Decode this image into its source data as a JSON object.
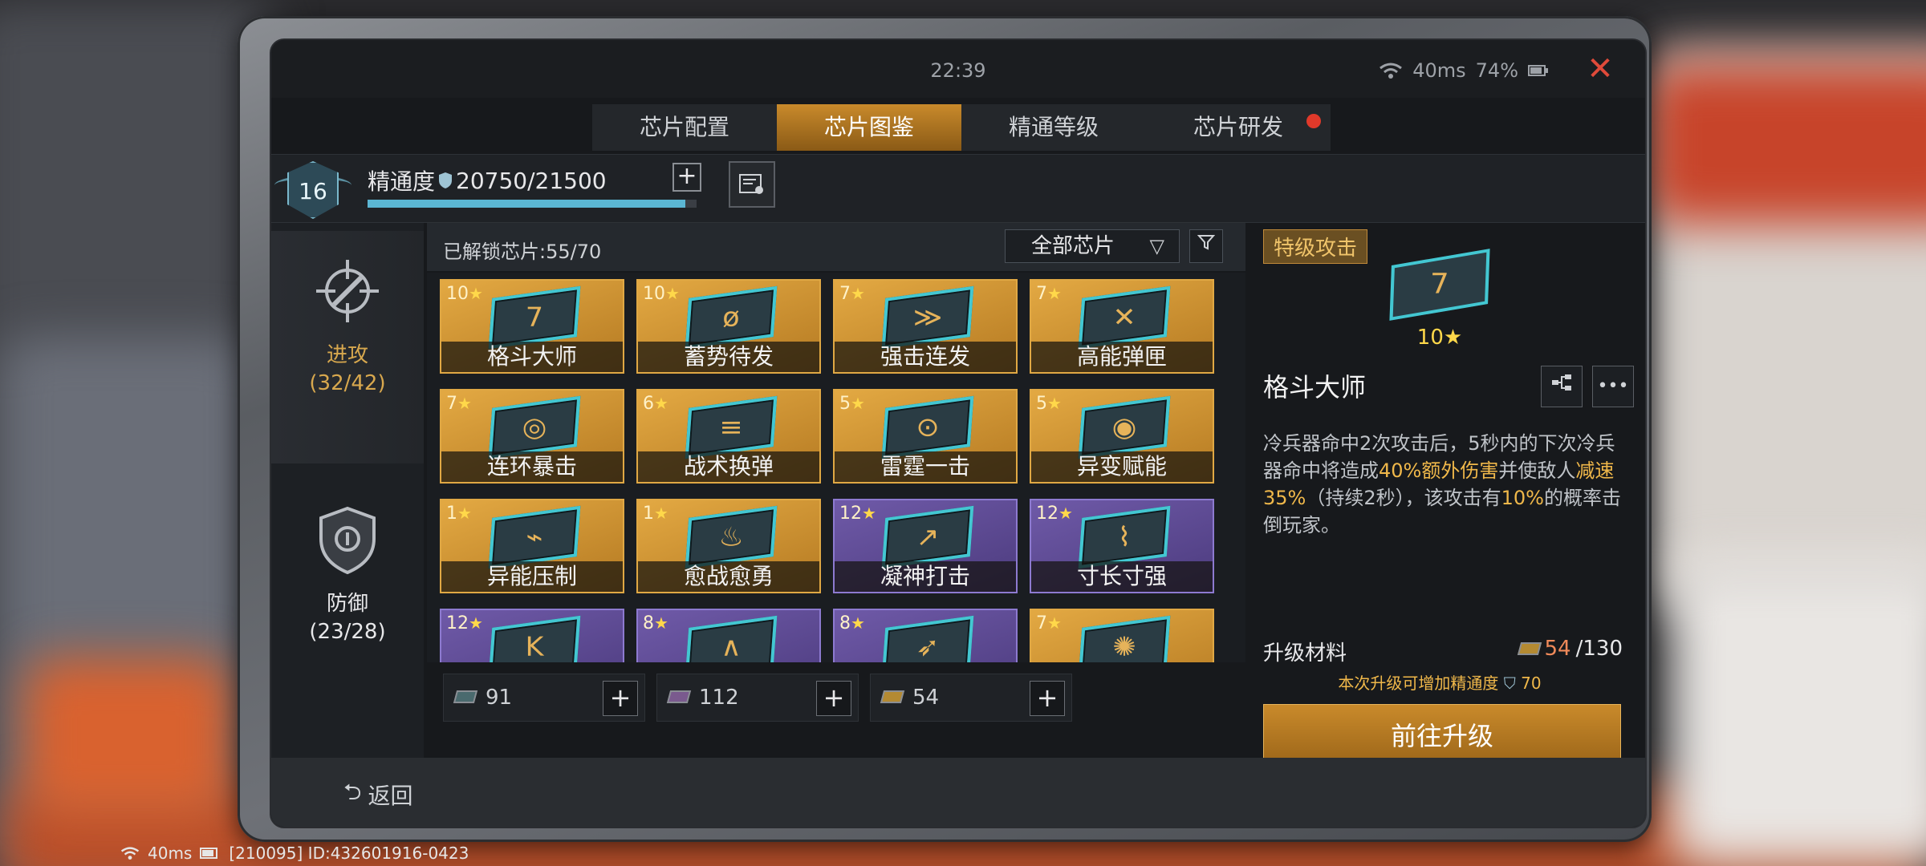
{
  "status": {
    "time": "22:39",
    "ping": "40ms",
    "battery": "74%"
  },
  "tabs": [
    {
      "label": "芯片配置"
    },
    {
      "label": "芯片图鉴"
    },
    {
      "label": "精通等级"
    },
    {
      "label": "芯片研发"
    }
  ],
  "proficiency": {
    "level": "16",
    "label": "精通度",
    "value": "20750/21500",
    "progress": 0.965
  },
  "categories": [
    {
      "name": "进攻",
      "count": "(32/42)"
    },
    {
      "name": "防御",
      "count": "(23/28)"
    }
  ],
  "grid": {
    "unlocked": "已解锁芯片:55/70",
    "filter": "全部芯片",
    "cards": [
      {
        "level": "10",
        "name": "格斗大师",
        "glyph": "7"
      },
      {
        "level": "10",
        "name": "蓄势待发",
        "glyph": "ø"
      },
      {
        "level": "7",
        "name": "强击连发",
        "glyph": "≫"
      },
      {
        "level": "7",
        "name": "高能弹匣",
        "glyph": "✕"
      },
      {
        "level": "7",
        "name": "连环暴击",
        "glyph": "◎"
      },
      {
        "level": "6",
        "name": "战术换弹",
        "glyph": "≡"
      },
      {
        "level": "5",
        "name": "雷霆一击",
        "glyph": "⊙"
      },
      {
        "level": "5",
        "name": "异变赋能",
        "glyph": "◉"
      },
      {
        "level": "1",
        "name": "异能压制",
        "glyph": "⌁"
      },
      {
        "level": "1",
        "name": "愈战愈勇",
        "glyph": "♨"
      },
      {
        "level": "12",
        "name": "凝神打击",
        "glyph": "↗"
      },
      {
        "level": "12",
        "name": "寸长寸强",
        "glyph": "⌇"
      },
      {
        "level": "12",
        "name": "",
        "glyph": "K"
      },
      {
        "level": "8",
        "name": "",
        "glyph": "∧"
      },
      {
        "level": "8",
        "name": "",
        "glyph": "➶"
      },
      {
        "level": "7",
        "name": "",
        "glyph": "✺"
      }
    ]
  },
  "resources": [
    {
      "amount": "91"
    },
    {
      "amount": "112"
    },
    {
      "amount": "54"
    }
  ],
  "detail": {
    "tag": "特级攻击",
    "level": "10",
    "name": "格斗大师",
    "glyph": "7",
    "desc": {
      "p1": "冷兵器命中2次攻击后，5秒内的下次冷兵器命中将造成",
      "hl1": "40%额外伤害",
      "p2": "并使敌人",
      "hl2": "减速35%",
      "p3": "（持续2秒），该攻击有",
      "hl3": "10%",
      "p4": "的概率击倒玩家。"
    },
    "material_label": "升级材料",
    "material_have": "54",
    "material_need": "/130",
    "note": "本次升级可增加精通度",
    "note_value": "70",
    "upgrade_label": "前往升级"
  },
  "back_label": "返回",
  "footer": {
    "ping": "40ms",
    "id": "[210095] ID:432601916-0423"
  },
  "colors": {
    "accent": "#c98a2b",
    "gold_card": "#e3a943",
    "purple_card": "#6f5aa8",
    "highlight": "#f0b84a",
    "close": "#e04a3a"
  }
}
